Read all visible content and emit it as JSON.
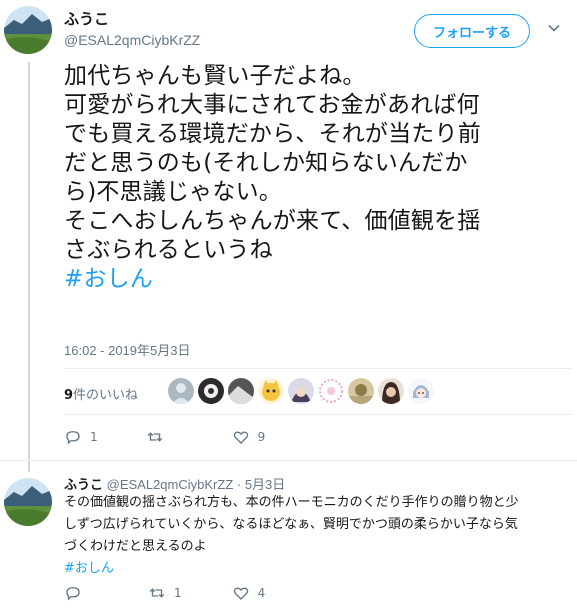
{
  "tweet": {
    "author_name": "ふうこ",
    "author_handle": "@ESAL2qmCiybKrZZ",
    "follow_label": "フォローする",
    "text_lines": [
      "加代ちゃんも賢い子だよね。",
      "可愛がられ大事にされてお金があれば何",
      "でも買える環境だから、それが当たり前",
      "だと思うのも(それしか知らないんだか",
      "ら)不思議じゃない。",
      "そこへおしんちゃんが来て、価値観を揺",
      "さぶられるというね"
    ],
    "hashtag": "#おしん",
    "timestamp": "16:02 - 2019年5月3日",
    "likes_count": "9",
    "likes_label": "件のいいね",
    "replies": "1",
    "retweets": "",
    "likes": "9",
    "liker_avatars": [
      "gray",
      "dark",
      "photo",
      "yellow-cat",
      "anime-dark",
      "pink-dots",
      "tan",
      "dark-hair",
      "anime-light"
    ]
  },
  "reply": {
    "author_name": "ふうこ",
    "author_handle": "@ESAL2qmCiybKrZZ",
    "date": "· 5月3日",
    "text_lines": [
      "その価値観の揺さぶられ方も、本の件ハーモニカのくだり手作りの贈り物と少",
      "しずつ広げられていくから、なるほどなぁ、賢明でかつ頭の柔らかい子なら気",
      "づくわけだと思えるのよ"
    ],
    "hashtag": "#おしん",
    "replies": "",
    "retweets": "1",
    "likes": "4"
  },
  "colors": {
    "accent": "#1da1f2",
    "secondary_text": "#657786",
    "divider": "#e6ecf0"
  },
  "icons": [
    "reply-icon",
    "retweet-icon",
    "like-icon",
    "chevron-down-icon"
  ]
}
